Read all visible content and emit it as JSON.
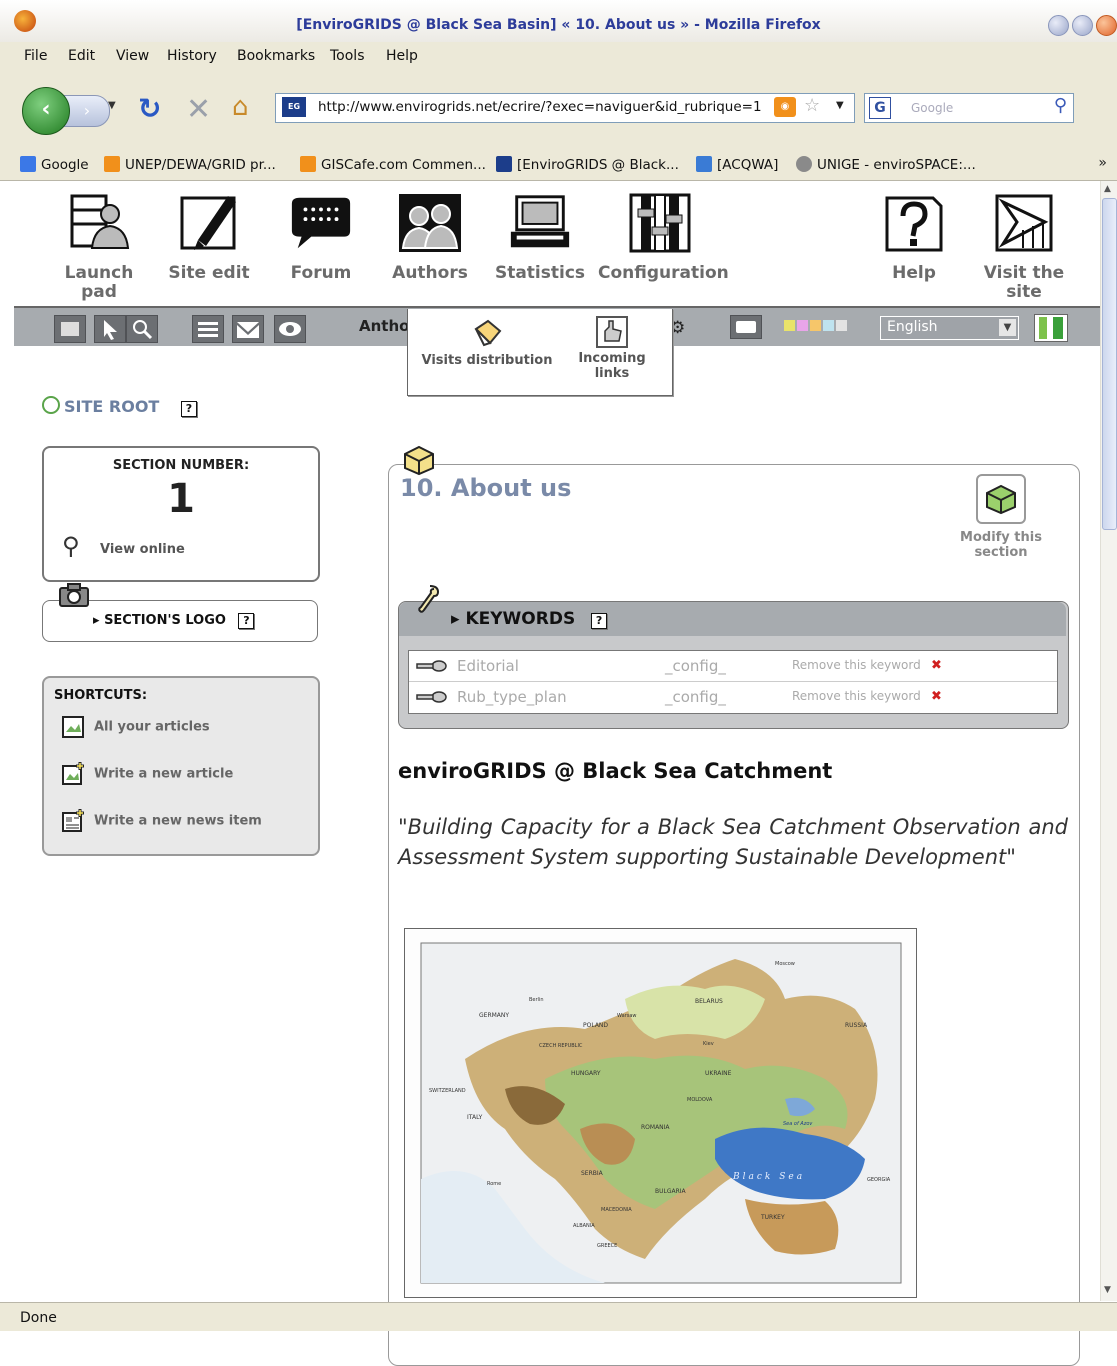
{
  "window": {
    "title": "[EnviroGRIDS @ Black Sea Basin] « 10. About us » - Mozilla Firefox"
  },
  "menu": [
    "File",
    "Edit",
    "View",
    "History",
    "Bookmarks",
    "Tools",
    "Help"
  ],
  "nav": {
    "url": "http://www.envirogrids.net/ecrire/?exec=naviguer&id_rubrique=1",
    "search_placeholder": "Google"
  },
  "bookmarks": [
    {
      "label": "Google",
      "color": "#3b78e7"
    },
    {
      "label": "UNEP/DEWA/GRID pr...",
      "color": "#f1901b"
    },
    {
      "label": "GISCafe.com Commen...",
      "color": "#f1901b"
    },
    {
      "label": "[EnviroGRIDS @ Black...",
      "color": "#1c3d8a"
    },
    {
      "label": "[ACQWA]",
      "color": "#3a7bd5"
    },
    {
      "label": "UNIGE - enviroSPACE:...",
      "color": "#8a8a8a"
    }
  ],
  "bookmarks_more": "»",
  "toolbar": {
    "items": [
      {
        "label": "Launch pad",
        "icon": "launch-pad-icon"
      },
      {
        "label": "Site edit",
        "icon": "site-edit-icon"
      },
      {
        "label": "Forum",
        "icon": "forum-icon"
      },
      {
        "label": "Authors",
        "icon": "authors-icon"
      },
      {
        "label": "Statistics",
        "icon": "statistics-icon"
      },
      {
        "label": "Configuration",
        "icon": "configuration-icon"
      }
    ],
    "help_label": "Help",
    "visit_label_1": "Visit the",
    "visit_label_2": "site"
  },
  "subbar": {
    "anth_text": "Antho",
    "language": "English"
  },
  "stats_popup": {
    "visits_label": "Visits distribution",
    "incoming_label_1": "Incoming",
    "incoming_label_2": "links"
  },
  "left": {
    "site_root": "SITE ROOT",
    "help_glyph": "?",
    "section_number_title": "SECTION NUMBER:",
    "section_number": "1",
    "view_online": "View online",
    "section_logo": "SECTION'S LOGO",
    "shortcuts_title": "SHORTCUTS:",
    "shortcuts": [
      "All your articles",
      "Write a new article",
      "Write a new news item"
    ]
  },
  "main": {
    "title": "10. About us",
    "modify_1": "Modify this",
    "modify_2": "section",
    "keywords_title": "KEYWORDS",
    "keywords": [
      {
        "name": "Editorial",
        "group": "_config_",
        "remove": "Remove this keyword",
        "x": "✖"
      },
      {
        "name": "Rub_type_plan",
        "group": "_config_",
        "remove": "Remove this keyword",
        "x": "✖"
      }
    ],
    "article_title": "enviroGRIDS @ Black Sea Catchment",
    "quote": "\"Building Capacity for a Black Sea Catchment Observation and Assessment System supporting Sustainable Development\""
  },
  "map": {
    "labels": {
      "germany": "GERMANY",
      "poland": "POLAND",
      "belarus": "BELARUS",
      "russia": "RUSSIA",
      "ukraine": "UKRAINE",
      "czech": "CZECH REPUBLIC",
      "hungary": "HUNGARY",
      "romania": "ROMANIA",
      "italy": "ITALY",
      "switzerland": "SWITZERLAND",
      "bulgaria": "BULGARIA",
      "serbia": "SERBIA",
      "greece": "GREECE",
      "albania": "ALBANIA",
      "moldova": "MOLDOVA",
      "georgia": "GEORGIA",
      "turkey": "TURKEY",
      "sea": "Black Sea",
      "azov": "Sea of Azov",
      "moscow": "Moscow",
      "berlin": "Berlin",
      "warsaw": "Warsaw",
      "kiev": "Kiev",
      "rome": "Rome",
      "macedonia": "MACEDONIA"
    }
  },
  "status": "Done"
}
